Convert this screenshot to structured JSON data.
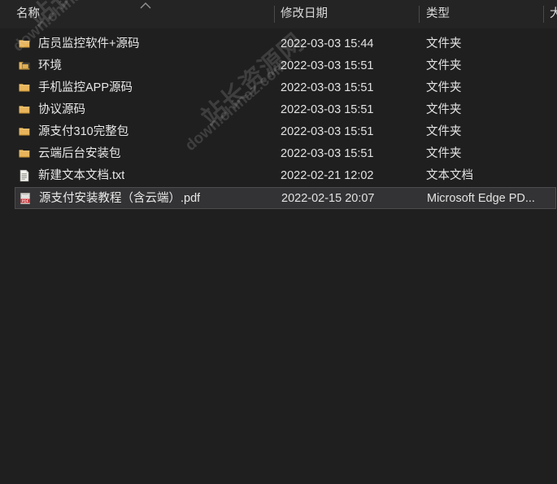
{
  "window": {
    "background_color": "#1f1f1f",
    "header_background_color": "#242424",
    "selection_color": "#333335"
  },
  "columns": {
    "name": "名称",
    "date_modified": "修改日期",
    "type": "类型",
    "size": "大"
  },
  "sort": {
    "column": "名称",
    "direction": "ascending",
    "icon": "chevron-up-icon"
  },
  "files": [
    {
      "name": "店员监控软件+源码",
      "date_modified": "2022-03-03 15:44",
      "type": "文件夹",
      "icon": "folder-icon",
      "selected": false
    },
    {
      "name": "环境",
      "date_modified": "2022-03-03 15:51",
      "type": "文件夹",
      "icon": "folder-open-icon",
      "selected": false
    },
    {
      "name": "手机监控APP源码",
      "date_modified": "2022-03-03 15:51",
      "type": "文件夹",
      "icon": "folder-icon",
      "selected": false
    },
    {
      "name": "协议源码",
      "date_modified": "2022-03-03 15:51",
      "type": "文件夹",
      "icon": "folder-icon",
      "selected": false
    },
    {
      "name": "源支付310完整包",
      "date_modified": "2022-03-03 15:51",
      "type": "文件夹",
      "icon": "folder-icon",
      "selected": false
    },
    {
      "name": "云端后台安装包",
      "date_modified": "2022-03-03 15:51",
      "type": "文件夹",
      "icon": "folder-icon",
      "selected": false
    },
    {
      "name": "新建文本文档.txt",
      "date_modified": "2022-02-21 12:02",
      "type": "文本文档",
      "icon": "text-file-icon",
      "selected": false
    },
    {
      "name": "源支付安装教程（含云端）.pdf",
      "date_modified": "2022-02-15 20:07",
      "type": "Microsoft Edge PD...",
      "icon": "pdf-file-icon",
      "selected": true
    }
  ],
  "watermark": {
    "line1": "站长资源网",
    "line2": "down.chinaz.com",
    "color": "rgba(225,225,225,0.16)"
  }
}
